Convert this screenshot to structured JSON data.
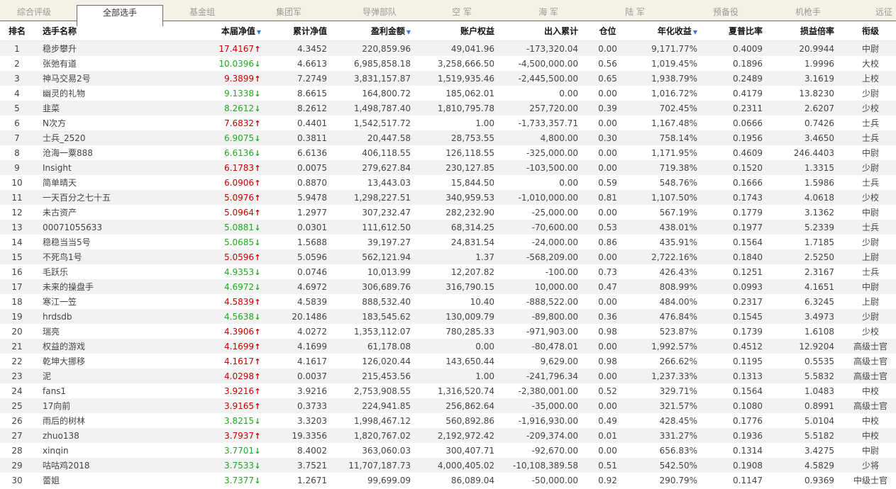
{
  "tabs": [
    {
      "label": "综合评级",
      "active": false
    },
    {
      "label": "全部选手",
      "active": true
    },
    {
      "label": "基金组",
      "active": false
    },
    {
      "label": "集团军",
      "active": false
    },
    {
      "label": "导弹部队",
      "active": false
    },
    {
      "label": "空  军",
      "active": false
    },
    {
      "label": "海  军",
      "active": false
    },
    {
      "label": "陆  军",
      "active": false
    },
    {
      "label": "预备役",
      "active": false
    },
    {
      "label": "机枪手",
      "active": false
    },
    {
      "label": "远征",
      "active": false
    }
  ],
  "columns": [
    {
      "key": "rank",
      "label": "排名",
      "sort": false
    },
    {
      "key": "name",
      "label": "选手名称",
      "sort": false
    },
    {
      "key": "nav",
      "label": "本届净值",
      "sort": true
    },
    {
      "key": "cum_nav",
      "label": "累计净值",
      "sort": false
    },
    {
      "key": "profit",
      "label": "盈利金额",
      "sort": true
    },
    {
      "key": "equity",
      "label": "账户权益",
      "sort": false
    },
    {
      "key": "flow",
      "label": "出入累计",
      "sort": false
    },
    {
      "key": "position",
      "label": "仓位",
      "sort": false
    },
    {
      "key": "annual",
      "label": "年化收益",
      "sort": true
    },
    {
      "key": "sharpe",
      "label": "夏普比率",
      "sort": false
    },
    {
      "key": "pl_ratio",
      "label": "损益倍率",
      "sort": false
    },
    {
      "key": "rank_title",
      "label": "衔级",
      "sort": false
    }
  ],
  "sort_icon": "sort-down-icon",
  "colors": {
    "up": "#cc0000",
    "down": "#22aa22",
    "stripe": "#f2f2f2",
    "tabbar": "#f4f1e6"
  },
  "rows": [
    {
      "rank": "1",
      "name": "稳步攀升",
      "nav": "17.4167",
      "dir": "up",
      "cum_nav": "4.3452",
      "profit": "220,859.96",
      "equity": "49,041.96",
      "flow": "-173,320.04",
      "position": "0.00",
      "annual": "9,171.77%",
      "sharpe": "0.4009",
      "pl_ratio": "20.9944",
      "rank_title": "中尉"
    },
    {
      "rank": "2",
      "name": "张弛有道",
      "nav": "10.0396",
      "dir": "down",
      "cum_nav": "4.6613",
      "profit": "6,985,858.18",
      "equity": "3,258,666.50",
      "flow": "-4,500,000.00",
      "position": "0.56",
      "annual": "1,019.45%",
      "sharpe": "0.1896",
      "pl_ratio": "1.9996",
      "rank_title": "大校"
    },
    {
      "rank": "3",
      "name": "神马交易2号",
      "nav": "9.3899",
      "dir": "up",
      "cum_nav": "7.2749",
      "profit": "3,831,157.87",
      "equity": "1,519,935.46",
      "flow": "-2,445,500.00",
      "position": "0.65",
      "annual": "1,938.79%",
      "sharpe": "0.2489",
      "pl_ratio": "3.1619",
      "rank_title": "上校"
    },
    {
      "rank": "4",
      "name": "幽灵的礼物",
      "nav": "9.1338",
      "dir": "down",
      "cum_nav": "8.6615",
      "profit": "164,800.72",
      "equity": "185,062.01",
      "flow": "0.00",
      "position": "0.00",
      "annual": "1,016.72%",
      "sharpe": "0.4179",
      "pl_ratio": "13.8230",
      "rank_title": "少尉"
    },
    {
      "rank": "5",
      "name": "韭菜",
      "nav": "8.2612",
      "dir": "down",
      "cum_nav": "8.2612",
      "profit": "1,498,787.40",
      "equity": "1,810,795.78",
      "flow": "257,720.00",
      "position": "0.39",
      "annual": "702.45%",
      "sharpe": "0.2311",
      "pl_ratio": "2.6207",
      "rank_title": "少校"
    },
    {
      "rank": "6",
      "name": "N次方",
      "nav": "7.6832",
      "dir": "up",
      "cum_nav": "0.4401",
      "profit": "1,542,517.72",
      "equity": "1.00",
      "flow": "-1,733,357.71",
      "position": "0.00",
      "annual": "1,167.48%",
      "sharpe": "0.0666",
      "pl_ratio": "0.7426",
      "rank_title": "士兵"
    },
    {
      "rank": "7",
      "name": "士兵_2520",
      "nav": "6.9075",
      "dir": "down",
      "cum_nav": "0.3811",
      "profit": "20,447.58",
      "equity": "28,753.55",
      "flow": "4,800.00",
      "position": "0.30",
      "annual": "758.14%",
      "sharpe": "0.1956",
      "pl_ratio": "3.4650",
      "rank_title": "士兵"
    },
    {
      "rank": "8",
      "name": "沧海一粟888",
      "nav": "6.6136",
      "dir": "down",
      "cum_nav": "6.6136",
      "profit": "406,118.55",
      "equity": "126,118.55",
      "flow": "-325,000.00",
      "position": "0.00",
      "annual": "1,171.95%",
      "sharpe": "0.4609",
      "pl_ratio": "246.4403",
      "rank_title": "中尉"
    },
    {
      "rank": "9",
      "name": "Insight",
      "nav": "6.1783",
      "dir": "up",
      "cum_nav": "0.0075",
      "profit": "279,627.84",
      "equity": "230,127.85",
      "flow": "-103,500.00",
      "position": "0.00",
      "annual": "719.38%",
      "sharpe": "0.1520",
      "pl_ratio": "1.3315",
      "rank_title": "少尉"
    },
    {
      "rank": "10",
      "name": "简单晴天",
      "nav": "6.0906",
      "dir": "up",
      "cum_nav": "0.8870",
      "profit": "13,443.03",
      "equity": "15,844.50",
      "flow": "0.00",
      "position": "0.59",
      "annual": "548.76%",
      "sharpe": "0.1666",
      "pl_ratio": "1.5986",
      "rank_title": "士兵"
    },
    {
      "rank": "11",
      "name": "一天百分之七十五",
      "nav": "5.0976",
      "dir": "up",
      "cum_nav": "5.9478",
      "profit": "1,298,227.51",
      "equity": "340,959.53",
      "flow": "-1,010,000.00",
      "position": "0.81",
      "annual": "1,107.50%",
      "sharpe": "0.1743",
      "pl_ratio": "4.0618",
      "rank_title": "少校"
    },
    {
      "rank": "12",
      "name": "未古资产",
      "nav": "5.0964",
      "dir": "up",
      "cum_nav": "1.2977",
      "profit": "307,232.47",
      "equity": "282,232.90",
      "flow": "-25,000.00",
      "position": "0.00",
      "annual": "567.19%",
      "sharpe": "0.1779",
      "pl_ratio": "3.1362",
      "rank_title": "中尉"
    },
    {
      "rank": "13",
      "name": "00071055633",
      "nav": "5.0881",
      "dir": "down",
      "cum_nav": "0.0301",
      "profit": "111,612.50",
      "equity": "68,314.25",
      "flow": "-70,600.00",
      "position": "0.53",
      "annual": "438.01%",
      "sharpe": "0.1977",
      "pl_ratio": "5.2339",
      "rank_title": "士兵"
    },
    {
      "rank": "14",
      "name": "稳稳当当5号",
      "nav": "5.0685",
      "dir": "down",
      "cum_nav": "1.5688",
      "profit": "39,197.27",
      "equity": "24,831.54",
      "flow": "-24,000.00",
      "position": "0.86",
      "annual": "435.91%",
      "sharpe": "0.1564",
      "pl_ratio": "1.7185",
      "rank_title": "少尉"
    },
    {
      "rank": "15",
      "name": "不死鸟1号",
      "nav": "5.0596",
      "dir": "up",
      "cum_nav": "5.0596",
      "profit": "562,121.94",
      "equity": "1.37",
      "flow": "-568,209.00",
      "position": "0.00",
      "annual": "2,722.16%",
      "sharpe": "0.1840",
      "pl_ratio": "2.5250",
      "rank_title": "上尉"
    },
    {
      "rank": "16",
      "name": "毛跃乐",
      "nav": "4.9353",
      "dir": "down",
      "cum_nav": "0.0746",
      "profit": "10,013.99",
      "equity": "12,207.82",
      "flow": "-100.00",
      "position": "0.73",
      "annual": "426.43%",
      "sharpe": "0.1251",
      "pl_ratio": "2.3167",
      "rank_title": "士兵"
    },
    {
      "rank": "17",
      "name": "未来的操盘手",
      "nav": "4.6972",
      "dir": "down",
      "cum_nav": "4.6972",
      "profit": "306,689.76",
      "equity": "316,790.15",
      "flow": "10,000.00",
      "position": "0.47",
      "annual": "808.99%",
      "sharpe": "0.0993",
      "pl_ratio": "4.1651",
      "rank_title": "中尉"
    },
    {
      "rank": "18",
      "name": "寒江一笠",
      "nav": "4.5839",
      "dir": "up",
      "cum_nav": "4.5839",
      "profit": "888,532.40",
      "equity": "10.40",
      "flow": "-888,522.00",
      "position": "0.00",
      "annual": "484.00%",
      "sharpe": "0.2317",
      "pl_ratio": "6.3245",
      "rank_title": "上尉"
    },
    {
      "rank": "19",
      "name": "hrdsdb",
      "nav": "4.5638",
      "dir": "down",
      "cum_nav": "20.1486",
      "profit": "183,545.62",
      "equity": "130,009.79",
      "flow": "-89,800.00",
      "position": "0.36",
      "annual": "476.84%",
      "sharpe": "0.1545",
      "pl_ratio": "3.4973",
      "rank_title": "少尉"
    },
    {
      "rank": "20",
      "name": "瑞亮",
      "nav": "4.3906",
      "dir": "up",
      "cum_nav": "4.0272",
      "profit": "1,353,112.07",
      "equity": "780,285.33",
      "flow": "-971,903.00",
      "position": "0.98",
      "annual": "523.87%",
      "sharpe": "0.1739",
      "pl_ratio": "1.6108",
      "rank_title": "少校"
    },
    {
      "rank": "21",
      "name": "权益的游戏",
      "nav": "4.1699",
      "dir": "up",
      "cum_nav": "4.1699",
      "profit": "61,178.08",
      "equity": "0.00",
      "flow": "-80,478.01",
      "position": "0.00",
      "annual": "1,992.57%",
      "sharpe": "0.4512",
      "pl_ratio": "12.9204",
      "rank_title": "高级士官"
    },
    {
      "rank": "22",
      "name": "乾坤大挪移",
      "nav": "4.1617",
      "dir": "up",
      "cum_nav": "4.1617",
      "profit": "126,020.44",
      "equity": "143,650.44",
      "flow": "9,629.00",
      "position": "0.98",
      "annual": "266.62%",
      "sharpe": "0.1195",
      "pl_ratio": "0.5535",
      "rank_title": "高级士官"
    },
    {
      "rank": "23",
      "name": "泥",
      "nav": "4.0298",
      "dir": "up",
      "cum_nav": "0.0037",
      "profit": "215,453.56",
      "equity": "1.00",
      "flow": "-241,796.34",
      "position": "0.00",
      "annual": "1,237.33%",
      "sharpe": "0.1313",
      "pl_ratio": "5.5832",
      "rank_title": "高级士官"
    },
    {
      "rank": "24",
      "name": "fans1",
      "nav": "3.9216",
      "dir": "up",
      "cum_nav": "3.9216",
      "profit": "2,753,908.55",
      "equity": "1,316,520.74",
      "flow": "-2,380,001.00",
      "position": "0.52",
      "annual": "329.71%",
      "sharpe": "0.1564",
      "pl_ratio": "1.0483",
      "rank_title": "中校"
    },
    {
      "rank": "25",
      "name": "17向前",
      "nav": "3.9165",
      "dir": "up",
      "cum_nav": "0.3733",
      "profit": "224,941.85",
      "equity": "256,862.64",
      "flow": "-35,000.00",
      "position": "0.00",
      "annual": "321.57%",
      "sharpe": "0.1080",
      "pl_ratio": "0.8991",
      "rank_title": "高级士官"
    },
    {
      "rank": "26",
      "name": "雨后的树林",
      "nav": "3.8215",
      "dir": "down",
      "cum_nav": "3.3203",
      "profit": "1,998,467.12",
      "equity": "560,892.86",
      "flow": "-1,916,930.00",
      "position": "0.49",
      "annual": "428.45%",
      "sharpe": "0.1776",
      "pl_ratio": "5.0104",
      "rank_title": "中校"
    },
    {
      "rank": "27",
      "name": "zhuo138",
      "nav": "3.7937",
      "dir": "up",
      "cum_nav": "19.3356",
      "profit": "1,820,767.02",
      "equity": "2,192,972.42",
      "flow": "-209,374.00",
      "position": "0.01",
      "annual": "331.27%",
      "sharpe": "0.1936",
      "pl_ratio": "5.5182",
      "rank_title": "中校"
    },
    {
      "rank": "28",
      "name": "xinqin",
      "nav": "3.7701",
      "dir": "down",
      "cum_nav": "8.4002",
      "profit": "363,060.03",
      "equity": "300,407.71",
      "flow": "-92,670.00",
      "position": "0.00",
      "annual": "656.83%",
      "sharpe": "0.1314",
      "pl_ratio": "3.4275",
      "rank_title": "中尉"
    },
    {
      "rank": "29",
      "name": "咕咕鸡2018",
      "nav": "3.7533",
      "dir": "down",
      "cum_nav": "3.7521",
      "profit": "11,707,187.73",
      "equity": "4,000,405.02",
      "flow": "-10,108,389.58",
      "position": "0.51",
      "annual": "542.50%",
      "sharpe": "0.1908",
      "pl_ratio": "4.5829",
      "rank_title": "少将"
    },
    {
      "rank": "30",
      "name": "蕾姐",
      "nav": "3.7377",
      "dir": "down",
      "cum_nav": "1.2671",
      "profit": "99,699.09",
      "equity": "86,089.04",
      "flow": "-50,000.00",
      "position": "0.92",
      "annual": "290.79%",
      "sharpe": "0.1147",
      "pl_ratio": "0.9369",
      "rank_title": "中级士官"
    }
  ]
}
